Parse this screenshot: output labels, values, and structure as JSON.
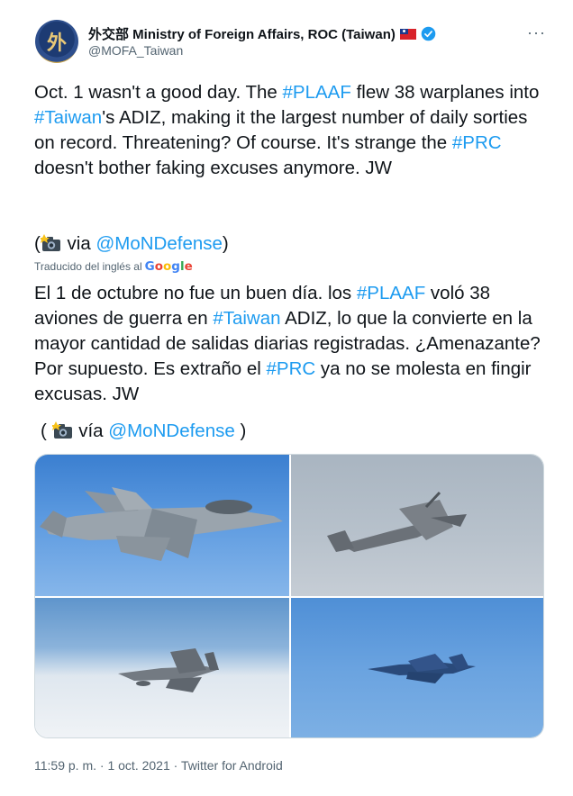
{
  "account": {
    "display_name": "外交部 Ministry of Foreign Affairs, ROC (Taiwan)",
    "handle": "@MOFA_Taiwan",
    "avatar_text": "外",
    "verified": true
  },
  "menu": {
    "more_label": "···"
  },
  "tweet": {
    "segments": [
      {
        "text": "Oct. 1 wasn't a good day. The ",
        "link": false
      },
      {
        "text": "#PLAAF",
        "link": true
      },
      {
        "text": " flew 38 warplanes into ",
        "link": false
      },
      {
        "text": "#Taiwan",
        "link": true
      },
      {
        "text": "'s ADIZ, making it the largest number of daily sorties on record. Threatening? Of course. It's strange the ",
        "link": false
      },
      {
        "text": "#PRC",
        "link": true
      },
      {
        "text": " doesn't bother faking excuses anymore. JW",
        "link": false
      }
    ],
    "via_open": "(",
    "via_word": "via",
    "via_link": "@MoNDefense",
    "via_close": ")"
  },
  "translation": {
    "label": "Traducido del inglés al",
    "provider": "Google",
    "segments": [
      {
        "text": "El 1 de octubre no fue un buen día. los ",
        "link": false
      },
      {
        "text": "#PLAAF",
        "link": true
      },
      {
        "text": " voló 38 aviones de guerra en ",
        "link": false
      },
      {
        "text": "#Taiwan",
        "link": true
      },
      {
        "text": " ADIZ, lo que la convierte en la mayor cantidad de salidas diarias registradas. ¿Amenazante? Por supuesto. Es extraño el ",
        "link": false
      },
      {
        "text": "#PRC",
        "link": true
      },
      {
        "text": " ya no se molesta en fingir excusas. JW",
        "link": false
      }
    ],
    "via_open": "(",
    "via_word": "vía",
    "via_link": "@MoNDefense",
    "via_close": ")"
  },
  "media": {
    "photos": [
      {
        "name": "fighter-jet-photo",
        "subject": "fighter jet"
      },
      {
        "name": "patrol-aircraft-photo",
        "subject": "patrol aircraft"
      },
      {
        "name": "bomber-photo",
        "subject": "bomber"
      },
      {
        "name": "blue-fighter-photo",
        "subject": "fighter jet"
      }
    ]
  },
  "meta": {
    "time": "11:59 p. m.",
    "date": "1 oct. 2021",
    "source": "Twitter for Android",
    "separator": " · "
  },
  "colors": {
    "link": "#1d9bf0",
    "text": "#0f1419",
    "muted": "#536471",
    "border": "#cfd9de"
  },
  "icons": [
    "verified-badge-icon",
    "taiwan-flag-icon",
    "camera-flash-icon",
    "google-logo",
    "more-options-icon"
  ]
}
